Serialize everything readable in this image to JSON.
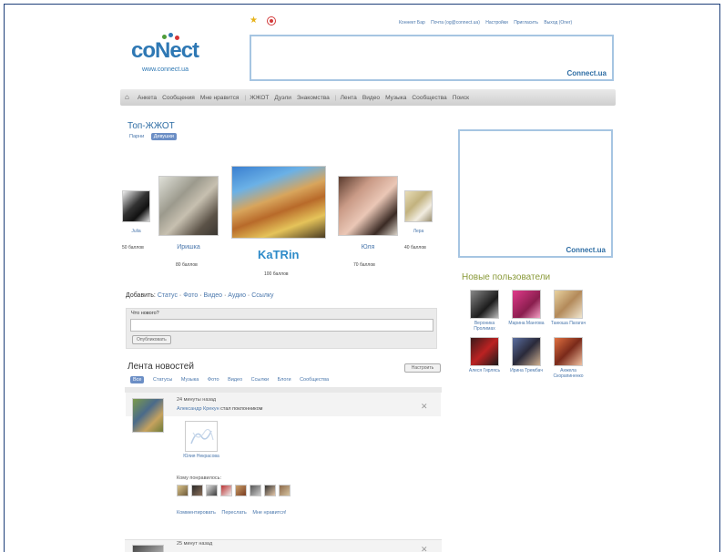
{
  "header": {
    "links": [
      "Коннект Бар",
      "Почта (og@connect.ua)",
      "Настройки",
      "Пригласить",
      "Выход (Oner)"
    ],
    "logo_text": "coNect",
    "logo_url": "www.connect.ua",
    "banner_label": "Connect.ua"
  },
  "nav": {
    "items": [
      "Анкета",
      "Сообщения",
      "Мне нравится",
      "ЖЖОТ",
      "Дуэли",
      "Знакомства",
      "Лента",
      "Видео",
      "Музыка",
      "Сообщества",
      "Поиск"
    ]
  },
  "top": {
    "title": "Топ-ЖЖОТ",
    "tabs": [
      "Парни",
      "Девушки"
    ],
    "people": [
      {
        "name": "Julia",
        "points": "50 баллов"
      },
      {
        "name": "Иришка",
        "points": "80 баллов"
      },
      {
        "name": "KaTRin",
        "points": "100 баллов"
      },
      {
        "name": "Юля",
        "points": "70 баллов"
      },
      {
        "name": "Лера",
        "points": "40 баллов"
      }
    ]
  },
  "compose": {
    "add_label": "Добавить:",
    "add_links": [
      "Статус",
      "Фото",
      "Видео",
      "Аудио",
      "Ссылку"
    ],
    "question": "Что нового?",
    "publish": "Опубликовать"
  },
  "feed": {
    "title": "Лента новостей",
    "settings": "Настроить",
    "filters": [
      "Все",
      "Статусы",
      "Музыка",
      "Фото",
      "Видео",
      "Ссылки",
      "Блоги",
      "Сообщества"
    ],
    "item1": {
      "time": "24 минуты назад",
      "author": "Александр Крекун",
      "action": "стал поклонником",
      "target_name": "Юлия Некрасова",
      "liked_label": "Кому понравилось:",
      "actions": [
        "Комментировать",
        "Переслать",
        "Мне нравится!"
      ]
    },
    "item2": {
      "time": "25 минут назад"
    }
  },
  "sidebar": {
    "banner_label": "Connect.ua",
    "new_users_title": "Новые пользователи",
    "users": [
      {
        "name": "Вероника Пролимах"
      },
      {
        "name": "Марина Мангова"
      },
      {
        "name": "Танюша Пагагач"
      },
      {
        "name": "Алеся Гирлясь"
      },
      {
        "name": "Ирина Трембач"
      },
      {
        "name": "Анжела Скорапиненко"
      }
    ]
  }
}
